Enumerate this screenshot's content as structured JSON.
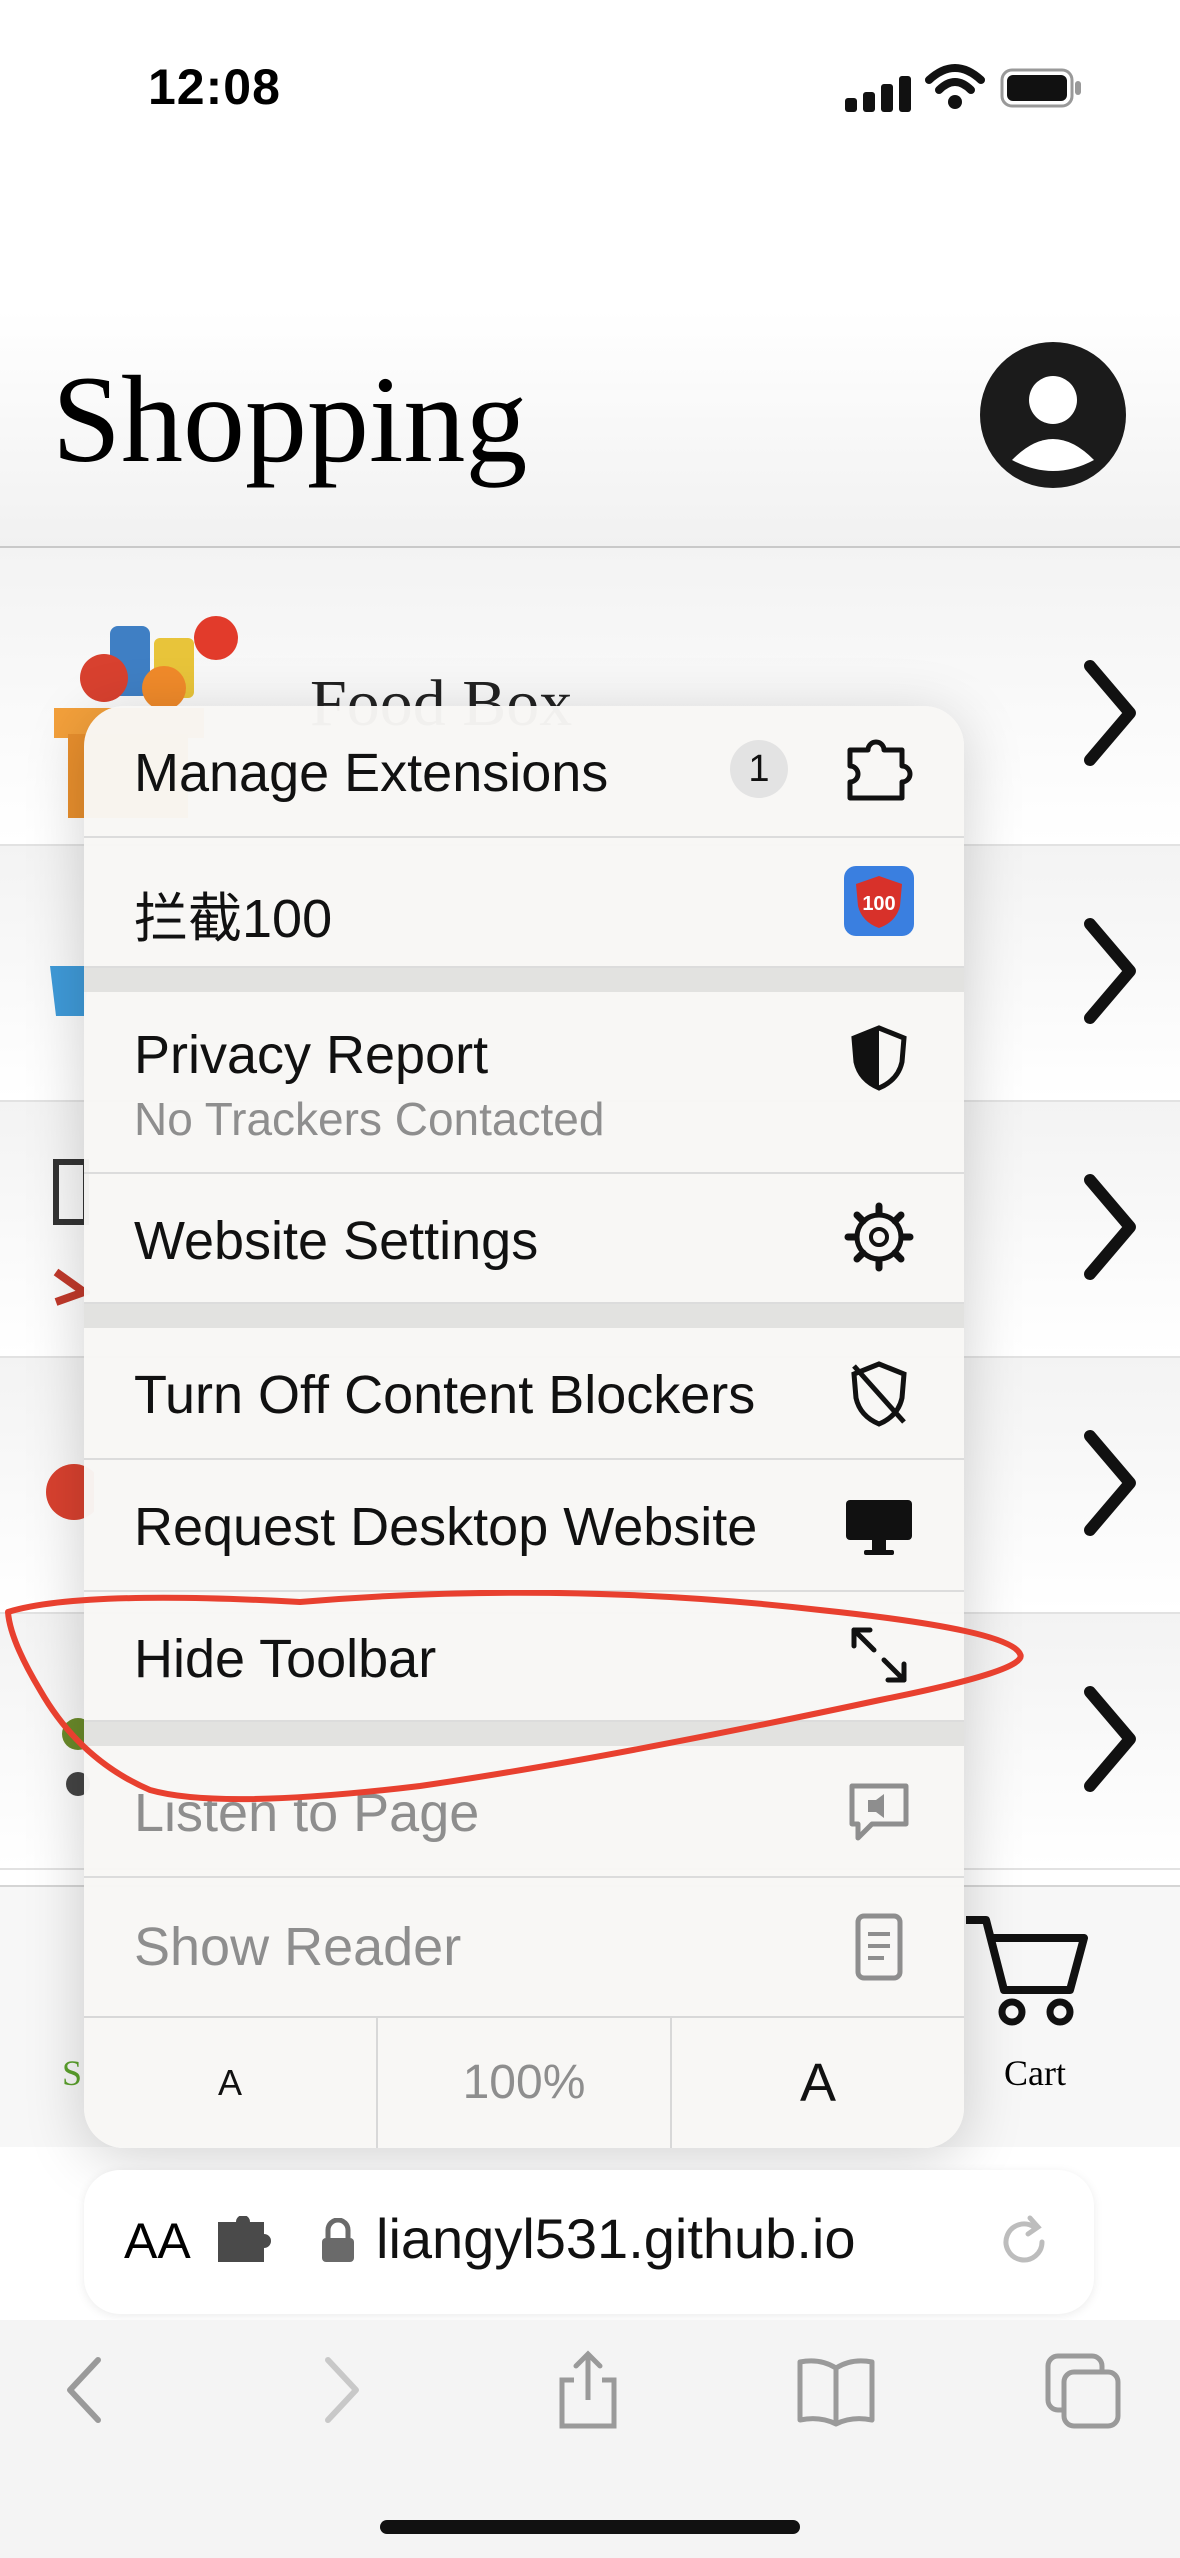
{
  "status_bar": {
    "time": "12:08"
  },
  "page": {
    "title": "Shopping",
    "rows": [
      {
        "label": "Food Box"
      }
    ],
    "tabbar": {
      "shop_label": "S",
      "cart_label": "Cart"
    }
  },
  "menu": {
    "manage_extensions": {
      "label": "Manage Extensions",
      "badge": "1"
    },
    "extension_item": {
      "label": "拦截100"
    },
    "privacy_report": {
      "label": "Privacy Report",
      "sub": "No Trackers Contacted"
    },
    "website_settings": {
      "label": "Website Settings"
    },
    "content_blockers": {
      "label": "Turn Off Content Blockers"
    },
    "desktop_site": {
      "label": "Request Desktop Website"
    },
    "hide_toolbar": {
      "label": "Hide Toolbar"
    },
    "listen": {
      "label": "Listen to Page"
    },
    "reader": {
      "label": "Show Reader"
    },
    "font_small": "A",
    "zoom": "100%",
    "font_large": "A"
  },
  "address_bar": {
    "aa": "AA",
    "url": "liangyl531.github.io"
  },
  "icons": {
    "avatar": "user-circle-icon",
    "chevron": "chevron-right-icon",
    "extensions": "puzzle-icon",
    "privacy": "shield-half-icon",
    "settings": "gear-icon",
    "blockers": "shield-slash-icon",
    "desktop": "monitor-icon",
    "hide_toolbar": "arrows-expand-icon",
    "listen": "speech-bubble-icon",
    "reader": "document-icon"
  },
  "colors": {
    "annotation": "#e8402f",
    "ext_blue": "#3a7fe0",
    "ext_red": "#d8312a",
    "cart_green": "#5aa02c"
  }
}
